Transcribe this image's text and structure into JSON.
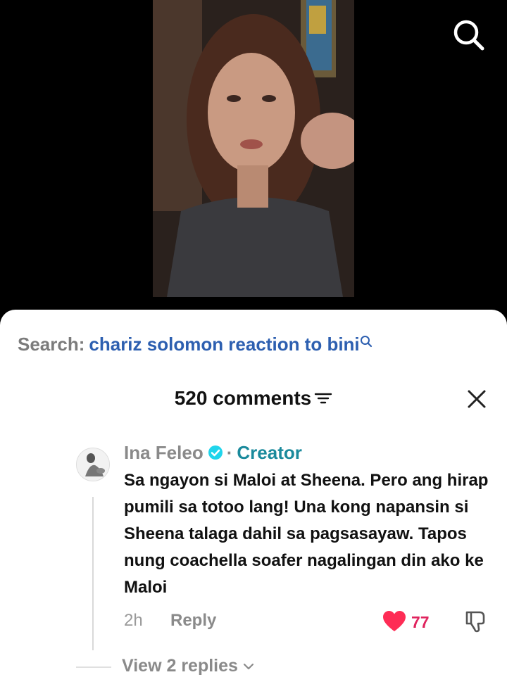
{
  "search": {
    "prefix": "Search:",
    "query": "chariz solomon reaction to bini"
  },
  "comments": {
    "count_label": "520 comments"
  },
  "comment": {
    "author": "Ina Feleo",
    "separator": "·",
    "badge": "Creator",
    "text": "Sa ngayon si Maloi at Sheena. Pero ang hirap pumili sa totoo lang! Una kong napansin si Sheena talaga dahil sa pagsasayaw. Tapos nung coachella soafer nagalingan din ako ke Maloi",
    "time": "2h",
    "reply_label": "Reply",
    "likes": "77",
    "view_replies": "View 2 replies"
  },
  "colors": {
    "link": "#2d5fb0",
    "creator": "#1a8a9c",
    "like": "#e0245e",
    "verified": "#20d5ec"
  },
  "icons": [
    "search-icon",
    "filter-icon",
    "close-icon",
    "verified-icon",
    "heart-icon",
    "dislike-icon",
    "chevron-down-icon"
  ]
}
